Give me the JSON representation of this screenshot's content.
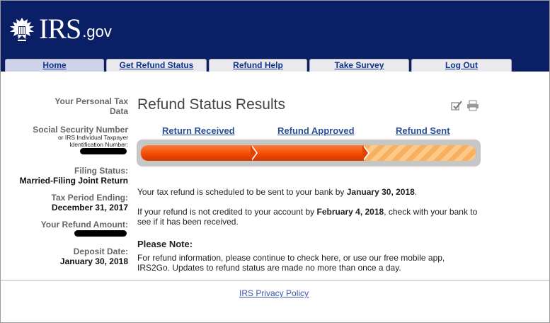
{
  "brand": {
    "logo_text": "IRS",
    "logo_suffix": ".gov"
  },
  "nav": {
    "tabs": [
      {
        "label": "Home",
        "active": true
      },
      {
        "label": "Get Refund Status",
        "active": false
      },
      {
        "label": "Refund Help",
        "active": false
      },
      {
        "label": "Take Survey",
        "active": false
      },
      {
        "label": "Log Out",
        "active": false
      }
    ]
  },
  "sidebar": {
    "heading": "Your Personal Tax Data",
    "ssn_label": "Social Security Number",
    "ssn_sub": "or IRS Individual Taxpayer Identification Number:",
    "filing_status_label": "Filing Status:",
    "filing_status_value": "Married-Filing Joint Return",
    "tax_period_label": "Tax Period Ending:",
    "tax_period_value": "December 31, 2017",
    "refund_amount_label": "Your Refund Amount:",
    "deposit_date_label": "Deposit Date:",
    "deposit_date_value": "January 30, 2018"
  },
  "main": {
    "title": "Refund Status Results",
    "steps": [
      "Return Received",
      "Refund Approved",
      "Refund Sent"
    ],
    "progress_completed_steps": 2,
    "msg1_text": "Your tax refund is scheduled to be sent to your bank by ",
    "msg1_date": "January 30, 2018",
    "msg1_end": ".",
    "msg2_text": "If your refund is not credited to your account by ",
    "msg2_date": "February 4, 2018",
    "msg2_end": ", check with your bank to see if it has been received.",
    "note_heading": "Please Note:",
    "note_text": "For refund information, please continue to check here, or use our free mobile app, IRS2Go. Updates to refund status are made no more than once a day."
  },
  "footer": {
    "privacy_link": "IRS Privacy Policy"
  },
  "colors": {
    "header_bg": "#0b1f66",
    "progress": "#f04a00",
    "link": "#2a4f96"
  }
}
